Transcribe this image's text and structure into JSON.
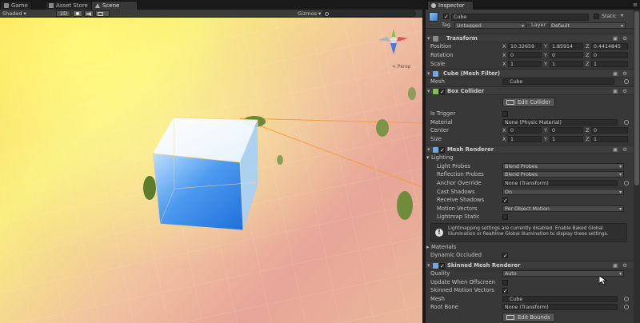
{
  "tabs": {
    "game": "Game",
    "asset_store": "Asset Store",
    "scene": "Scene",
    "inspector": "Inspector"
  },
  "scene_toolbar": {
    "shading": "Shaded",
    "mode_2d": "2D",
    "gizmos": "Gizmos"
  },
  "viewport": {
    "persp_label": "< Persp"
  },
  "object": {
    "name": "Cube",
    "static_label": "Static",
    "tag_label": "Tag",
    "tag_value": "Untagged",
    "layer_label": "Layer",
    "layer_value": "Default"
  },
  "transform": {
    "title": "Transform",
    "rows": [
      {
        "label": "Position",
        "x": "10.32659",
        "y": "1.85914",
        "z": "0.4414845"
      },
      {
        "label": "Rotation",
        "x": "0",
        "y": "0",
        "z": "0"
      },
      {
        "label": "Scale",
        "x": "1",
        "y": "1",
        "z": "1"
      }
    ],
    "x": "X",
    "y": "Y",
    "z": "Z"
  },
  "mesh_filter": {
    "title": "Cube (Mesh Filter)",
    "mesh_label": "Mesh",
    "mesh_value": "Cube"
  },
  "box_collider": {
    "title": "Box Collider",
    "edit_label": "Edit Collider",
    "is_trigger": "Is Trigger",
    "material": "Material",
    "material_value": "None (Physic Material)",
    "center": "Center",
    "center_x": "0",
    "center_y": "0",
    "center_z": "0",
    "size": "Size",
    "size_x": "1",
    "size_y": "1",
    "size_z": "1"
  },
  "mesh_renderer": {
    "title": "Mesh Renderer",
    "lighting": "Lighting",
    "light_probes": "Light Probes",
    "light_probes_value": "Blend Probes",
    "reflection_probes": "Reflection Probes",
    "reflection_probes_value": "Blend Probes",
    "anchor_override": "Anchor Override",
    "anchor_override_value": "None (Transform)",
    "cast_shadows": "Cast Shadows",
    "cast_shadows_value": "On",
    "receive_shadows": "Receive Shadows",
    "motion_vectors": "Motion Vectors",
    "motion_vectors_value": "Per Object Motion",
    "lightmap_static": "Lightmap Static",
    "help": "Lightmapping settings are currently disabled. Enable Baked Global Illumination or Realtime Global Illumination to display these settings.",
    "materials": "Materials",
    "dynamic_occluded": "Dynamic Occluded"
  },
  "skinned": {
    "title": "Skinned Mesh Renderer",
    "quality": "Quality",
    "quality_value": "Auto",
    "update_offscreen": "Update When Offscreen",
    "motion_vectors": "Skinned Motion Vectors",
    "mesh": "Mesh",
    "mesh_value": "Cube",
    "root_bone": "Root Bone",
    "root_bone_value": "None (Transform)",
    "edit_bounds": "Edit Bounds"
  },
  "colors": {
    "editor_bg": "#383838",
    "panel_dark": "#191919",
    "cube_blue": "#2f7fe0",
    "line_orange": "#f5a040"
  }
}
